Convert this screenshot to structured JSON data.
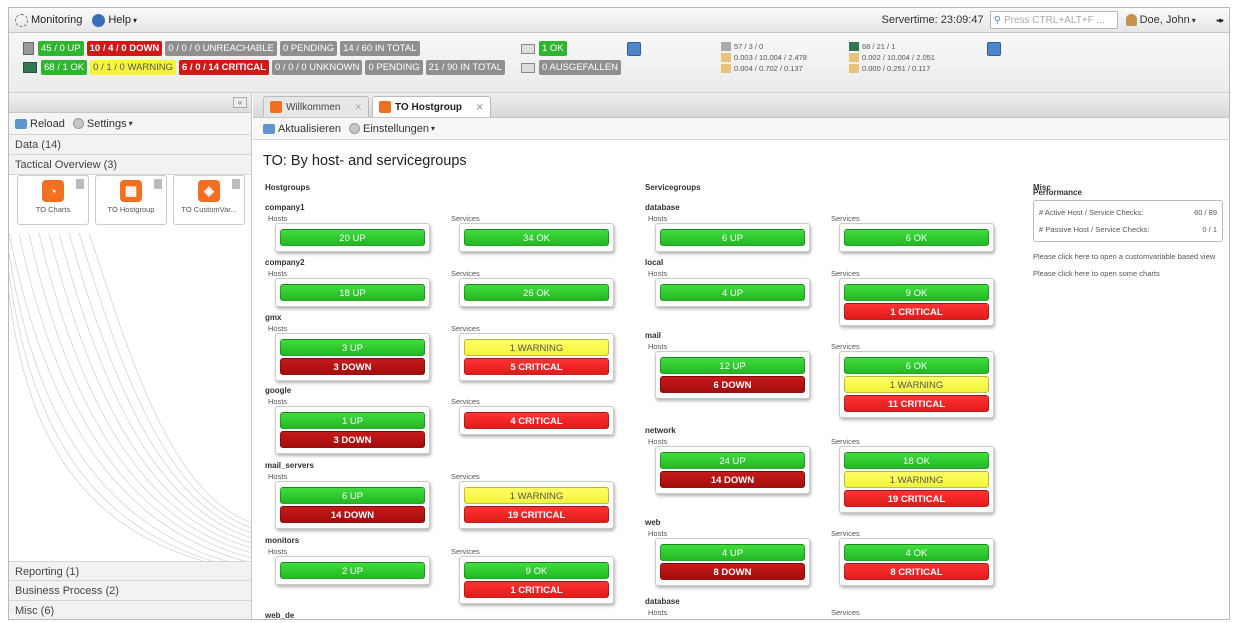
{
  "menu": {
    "monitoring": "Monitoring",
    "help": "Help",
    "servertime": "Servertime: 23:09:47",
    "search_placeholder": "Press CTRL+ALT+F ...",
    "user": "Doe, John"
  },
  "status": {
    "hosts": [
      "45 / 0 UP",
      "10 / 4 / 0 DOWN",
      "0 / 0 / 0 UNREACHABLE",
      "0 PENDING",
      "14 / 60 IN TOTAL"
    ],
    "services": [
      "68 / 1 OK",
      "0 / 1 / 0 WARNING",
      "6 / 0 / 14 CRITICAL",
      "0 / 0 / 0 UNKNOWN",
      "0 PENDING",
      "21 / 90 IN TOTAL"
    ],
    "extra1": "1 OK",
    "extra2": "0 AUSGEFALLEN",
    "perf1": [
      "57 / 3 / 0",
      "0.003 / 10.004 / 2.478",
      "0.004 / 0.702 / 0.137"
    ],
    "perf2": [
      "68 / 21 / 1",
      "0.002 / 10.004 / 2.051",
      "0.000 / 0.251 / 0.117"
    ]
  },
  "left": {
    "reload": "Reload",
    "settings": "Settings",
    "sections": [
      "Data (14)",
      "Tactical Overview (3)"
    ],
    "tiles": [
      {
        "label": "TO Charts",
        "icon": "pie-chart-icon",
        "color": "#f26f21"
      },
      {
        "label": "TO Hostgroup",
        "icon": "grid-icon",
        "color": "#f26f21"
      },
      {
        "label": "TO CustomVar...",
        "icon": "tag-icon",
        "color": "#f26f21"
      }
    ],
    "bottom": [
      "Reporting (1)",
      "Business Process (2)",
      "Misc (6)"
    ]
  },
  "main": {
    "tabs": [
      "Willkommen",
      "TO Hostgroup"
    ],
    "refresh": "Aktualisieren",
    "settings": "Einstellungen",
    "title": "TO: By host- and servicegroups",
    "col_hostgroups": "Hostgroups",
    "col_servicegroups": "Servicegroups",
    "col_misc": "Misc",
    "hosts_label": "Hosts",
    "services_label": "Services"
  },
  "hostgroups": [
    {
      "name": "company1",
      "hosts": [
        "20 UP"
      ],
      "services": [
        "34 OK"
      ]
    },
    {
      "name": "company2",
      "hosts": [
        "18 UP"
      ],
      "services": [
        "26 OK"
      ]
    },
    {
      "name": "gmx",
      "hosts": [
        "3 UP",
        "3 DOWN"
      ],
      "services": [
        "1 WARNING",
        "5 CRITICAL"
      ]
    },
    {
      "name": "google",
      "hosts": [
        "1 UP",
        "3 DOWN"
      ],
      "services": [
        "4 CRITICAL"
      ]
    },
    {
      "name": "mail_servers",
      "hosts": [
        "6 UP",
        "14 DOWN"
      ],
      "services": [
        "1 WARNING",
        "19 CRITICAL"
      ]
    },
    {
      "name": "monitors",
      "hosts": [
        "2 UP"
      ],
      "services": [
        "9 OK",
        "1 CRITICAL"
      ]
    },
    {
      "name": "web_de",
      "hosts": [],
      "services": []
    }
  ],
  "servicegroups": [
    {
      "name": "database",
      "hosts": [
        "6 UP"
      ],
      "services": [
        "6 OK"
      ]
    },
    {
      "name": "local",
      "hosts": [
        "4 UP"
      ],
      "services": [
        "9 OK",
        "1 CRITICAL"
      ]
    },
    {
      "name": "mail",
      "hosts": [
        "12 UP",
        "6 DOWN"
      ],
      "services": [
        "6 OK",
        "1 WARNING",
        "11 CRITICAL"
      ]
    },
    {
      "name": "network",
      "hosts": [
        "24 UP",
        "14 DOWN"
      ],
      "services": [
        "18 OK",
        "1 WARNING",
        "19 CRITICAL"
      ]
    },
    {
      "name": "web",
      "hosts": [
        "4 UP",
        "8 DOWN"
      ],
      "services": [
        "4 OK",
        "8 CRITICAL"
      ]
    },
    {
      "name": "database",
      "hosts": [],
      "services": []
    }
  ],
  "misc": {
    "performance": "Performance",
    "rows": [
      {
        "label": "# Active Host / Service Checks:",
        "value": "60 / 89"
      },
      {
        "label": "# Passive Host / Service Checks:",
        "value": "0 / 1"
      }
    ],
    "links": [
      "Please click here to open a customvariable based view",
      "Please click here to open some charts"
    ]
  }
}
